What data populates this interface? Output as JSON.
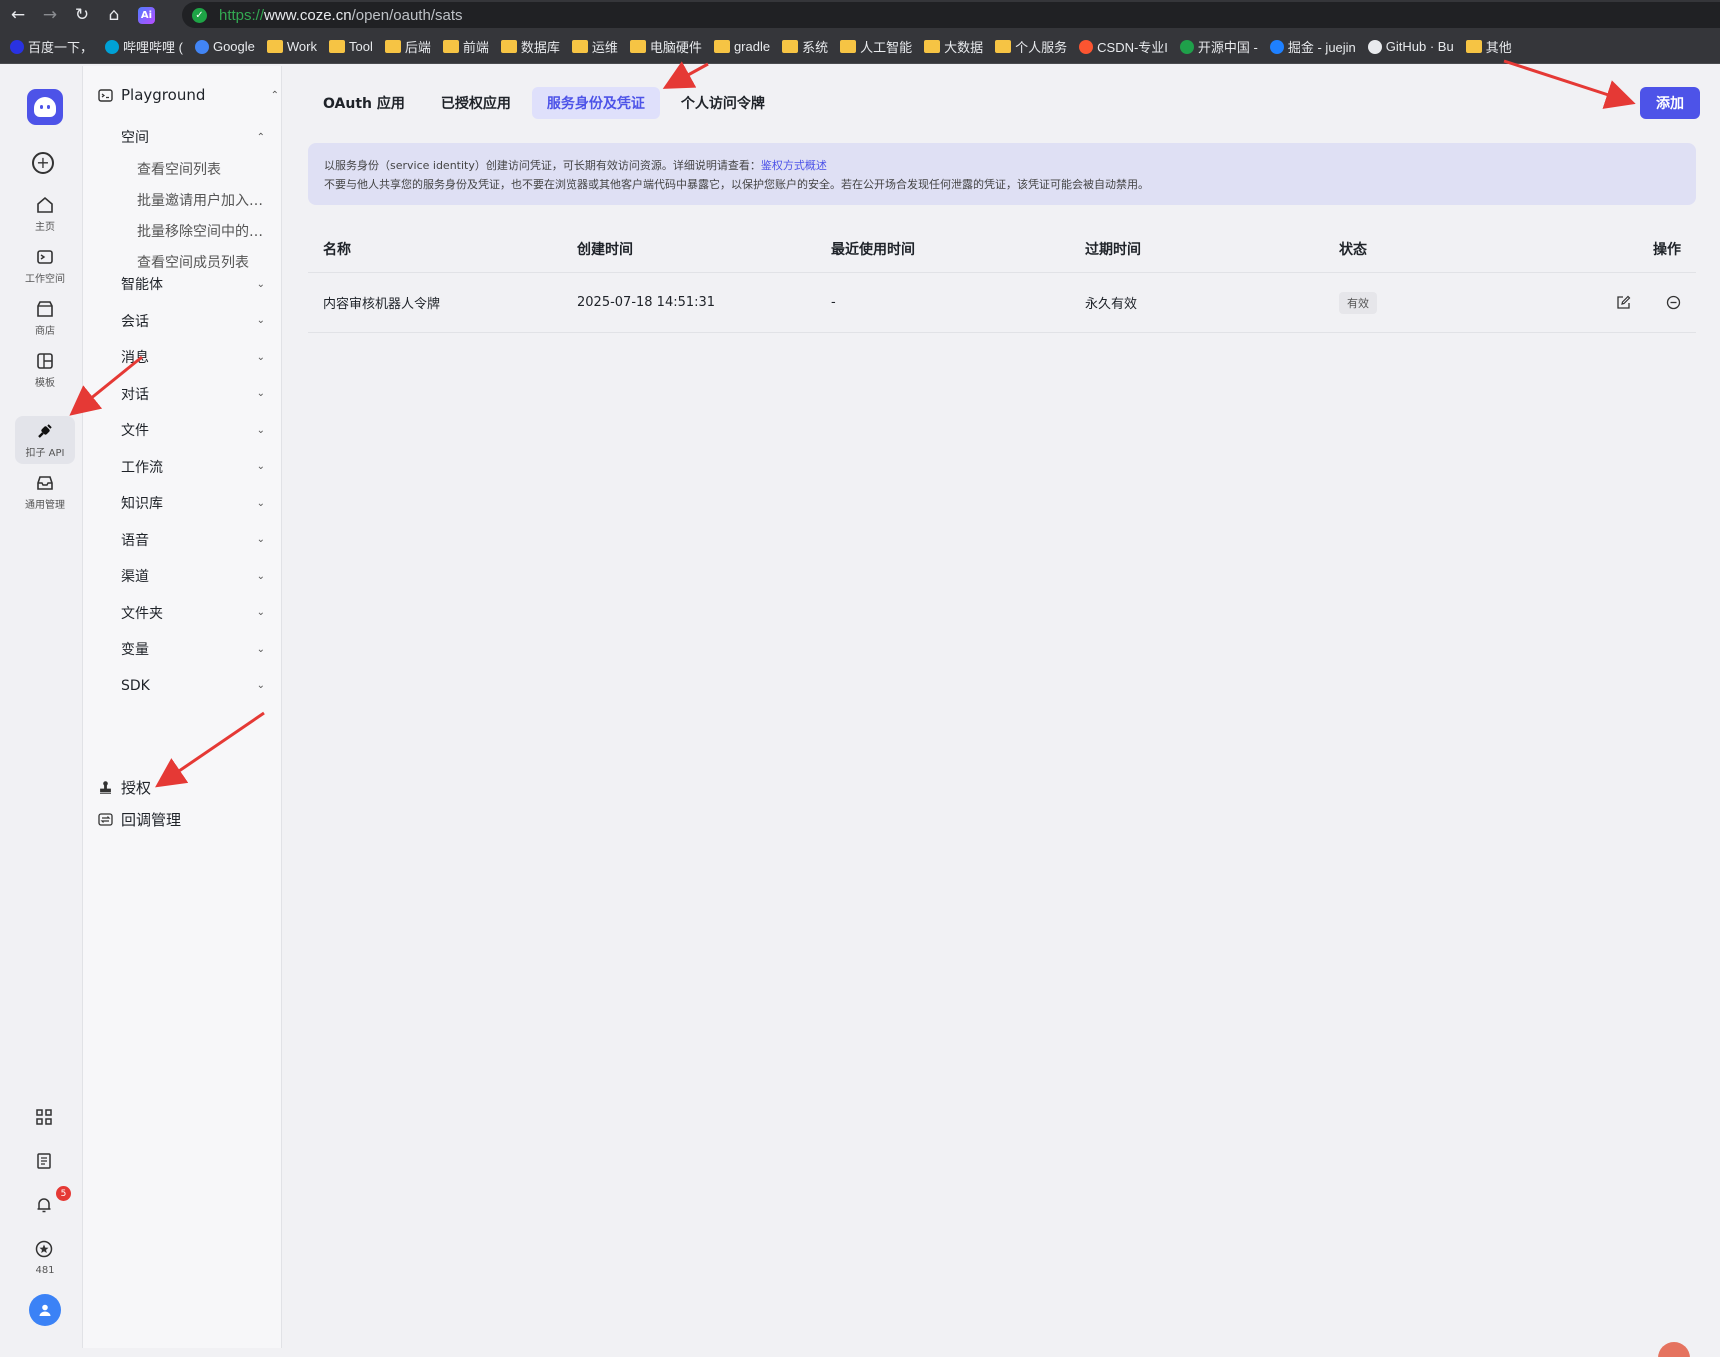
{
  "browser": {
    "url_scheme": "https://",
    "url_host": "www.coze.cn",
    "url_path": "/open/oauth/sats",
    "ai_badge": "Ai",
    "bookmarks": [
      {
        "label": "百度一下，",
        "icon": "baidu-icon",
        "color": "#2932e1"
      },
      {
        "label": "哔哩哔哩 (",
        "icon": "bilibili-icon",
        "color": "#00a1d6"
      },
      {
        "label": "Google",
        "icon": "google-icon",
        "color": "#4285f4"
      },
      {
        "label": "Work",
        "icon": "folder-icon",
        "color": "#f6c444"
      },
      {
        "label": "Tool",
        "icon": "folder-icon",
        "color": "#f6c444"
      },
      {
        "label": "后端",
        "icon": "folder-icon",
        "color": "#f6c444"
      },
      {
        "label": "前端",
        "icon": "folder-icon",
        "color": "#f6c444"
      },
      {
        "label": "数据库",
        "icon": "folder-icon",
        "color": "#f6c444"
      },
      {
        "label": "运维",
        "icon": "folder-icon",
        "color": "#f6c444"
      },
      {
        "label": "电脑硬件",
        "icon": "folder-icon",
        "color": "#f6c444"
      },
      {
        "label": "gradle",
        "icon": "folder-icon",
        "color": "#f6c444"
      },
      {
        "label": "系统",
        "icon": "folder-icon",
        "color": "#f6c444"
      },
      {
        "label": "人工智能",
        "icon": "folder-icon",
        "color": "#f6c444"
      },
      {
        "label": "大数据",
        "icon": "folder-icon",
        "color": "#f6c444"
      },
      {
        "label": "个人服务",
        "icon": "folder-icon",
        "color": "#f6c444"
      },
      {
        "label": "CSDN-专业I",
        "icon": "csdn-icon",
        "color": "#fc5531"
      },
      {
        "label": "开源中国 -",
        "icon": "oschina-icon",
        "color": "#1fa04a"
      },
      {
        "label": "掘金 - juejin",
        "icon": "juejin-icon",
        "color": "#1e80ff"
      },
      {
        "label": "GitHub · Bu",
        "icon": "github-icon",
        "color": "#e8eaed"
      },
      {
        "label": "其他",
        "icon": "folder-icon",
        "color": "#f6c444"
      }
    ]
  },
  "rail": {
    "items": [
      {
        "label": "主页",
        "icon": "home-icon"
      },
      {
        "label": "工作空间",
        "icon": "workspace-icon"
      },
      {
        "label": "商店",
        "icon": "store-icon"
      },
      {
        "label": "模板",
        "icon": "template-icon"
      },
      {
        "label": "扣子 API",
        "icon": "api-plug-icon",
        "active": true
      },
      {
        "label": "通用管理",
        "icon": "inbox-icon"
      }
    ],
    "notification_count": "5",
    "points": "481"
  },
  "sidebar": {
    "playground": "Playground",
    "space": "空间",
    "space_children": [
      "查看空间列表",
      "批量邀请用户加入…",
      "批量移除空间中的…",
      "查看空间成员列表"
    ],
    "groups": [
      "智能体",
      "会话",
      "消息",
      "对话",
      "文件",
      "工作流",
      "知识库",
      "语音",
      "渠道",
      "文件夹",
      "变量",
      "SDK"
    ],
    "auth": "授权",
    "callback": "回调管理"
  },
  "main": {
    "tabs": [
      "OAuth 应用",
      "已授权应用",
      "服务身份及凭证",
      "个人访问令牌"
    ],
    "active_tab": "服务身份及凭证",
    "add_label": "添加",
    "notice_line1": "以服务身份（service identity）创建访问凭证，可长期有效访问资源。详细说明请查看：",
    "notice_link": "鉴权方式概述",
    "notice_line2": "不要与他人共享您的服务身份及凭证，也不要在浏览器或其他客户端代码中暴露它，以保护您账户的安全。若在公开场合发现任何泄露的凭证，该凭证可能会被自动禁用。",
    "columns": [
      "名称",
      "创建时间",
      "最近使用时间",
      "过期时间",
      "状态",
      "操作"
    ],
    "rows": [
      {
        "name": "内容审核机器人令牌",
        "created": "2025-07-18 14:51:31",
        "last_used": "-",
        "expires": "永久有效",
        "status": "有效"
      }
    ]
  },
  "colors": {
    "accent": "#4d53e8",
    "annotation_arrow": "#e53935"
  }
}
